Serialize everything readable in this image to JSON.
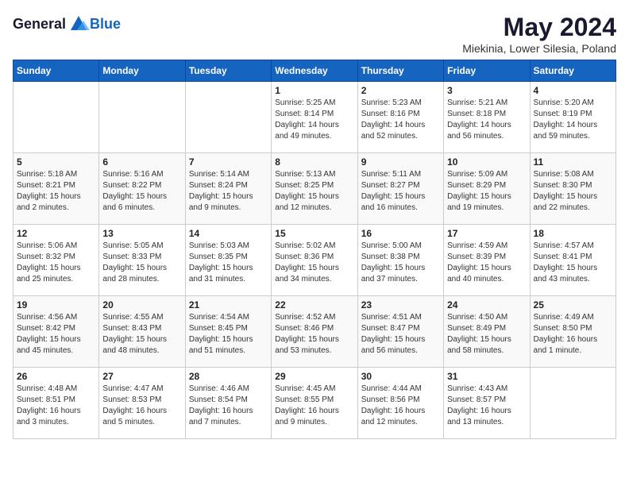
{
  "logo": {
    "text_general": "General",
    "text_blue": "Blue"
  },
  "title": "May 2024",
  "location": "Miekinia, Lower Silesia, Poland",
  "weekdays": [
    "Sunday",
    "Monday",
    "Tuesday",
    "Wednesday",
    "Thursday",
    "Friday",
    "Saturday"
  ],
  "weeks": [
    [
      {
        "day": "",
        "sunrise": "",
        "sunset": "",
        "daylight": ""
      },
      {
        "day": "",
        "sunrise": "",
        "sunset": "",
        "daylight": ""
      },
      {
        "day": "",
        "sunrise": "",
        "sunset": "",
        "daylight": ""
      },
      {
        "day": "1",
        "sunrise": "Sunrise: 5:25 AM",
        "sunset": "Sunset: 8:14 PM",
        "daylight": "Daylight: 14 hours and 49 minutes."
      },
      {
        "day": "2",
        "sunrise": "Sunrise: 5:23 AM",
        "sunset": "Sunset: 8:16 PM",
        "daylight": "Daylight: 14 hours and 52 minutes."
      },
      {
        "day": "3",
        "sunrise": "Sunrise: 5:21 AM",
        "sunset": "Sunset: 8:18 PM",
        "daylight": "Daylight: 14 hours and 56 minutes."
      },
      {
        "day": "4",
        "sunrise": "Sunrise: 5:20 AM",
        "sunset": "Sunset: 8:19 PM",
        "daylight": "Daylight: 14 hours and 59 minutes."
      }
    ],
    [
      {
        "day": "5",
        "sunrise": "Sunrise: 5:18 AM",
        "sunset": "Sunset: 8:21 PM",
        "daylight": "Daylight: 15 hours and 2 minutes."
      },
      {
        "day": "6",
        "sunrise": "Sunrise: 5:16 AM",
        "sunset": "Sunset: 8:22 PM",
        "daylight": "Daylight: 15 hours and 6 minutes."
      },
      {
        "day": "7",
        "sunrise": "Sunrise: 5:14 AM",
        "sunset": "Sunset: 8:24 PM",
        "daylight": "Daylight: 15 hours and 9 minutes."
      },
      {
        "day": "8",
        "sunrise": "Sunrise: 5:13 AM",
        "sunset": "Sunset: 8:25 PM",
        "daylight": "Daylight: 15 hours and 12 minutes."
      },
      {
        "day": "9",
        "sunrise": "Sunrise: 5:11 AM",
        "sunset": "Sunset: 8:27 PM",
        "daylight": "Daylight: 15 hours and 16 minutes."
      },
      {
        "day": "10",
        "sunrise": "Sunrise: 5:09 AM",
        "sunset": "Sunset: 8:29 PM",
        "daylight": "Daylight: 15 hours and 19 minutes."
      },
      {
        "day": "11",
        "sunrise": "Sunrise: 5:08 AM",
        "sunset": "Sunset: 8:30 PM",
        "daylight": "Daylight: 15 hours and 22 minutes."
      }
    ],
    [
      {
        "day": "12",
        "sunrise": "Sunrise: 5:06 AM",
        "sunset": "Sunset: 8:32 PM",
        "daylight": "Daylight: 15 hours and 25 minutes."
      },
      {
        "day": "13",
        "sunrise": "Sunrise: 5:05 AM",
        "sunset": "Sunset: 8:33 PM",
        "daylight": "Daylight: 15 hours and 28 minutes."
      },
      {
        "day": "14",
        "sunrise": "Sunrise: 5:03 AM",
        "sunset": "Sunset: 8:35 PM",
        "daylight": "Daylight: 15 hours and 31 minutes."
      },
      {
        "day": "15",
        "sunrise": "Sunrise: 5:02 AM",
        "sunset": "Sunset: 8:36 PM",
        "daylight": "Daylight: 15 hours and 34 minutes."
      },
      {
        "day": "16",
        "sunrise": "Sunrise: 5:00 AM",
        "sunset": "Sunset: 8:38 PM",
        "daylight": "Daylight: 15 hours and 37 minutes."
      },
      {
        "day": "17",
        "sunrise": "Sunrise: 4:59 AM",
        "sunset": "Sunset: 8:39 PM",
        "daylight": "Daylight: 15 hours and 40 minutes."
      },
      {
        "day": "18",
        "sunrise": "Sunrise: 4:57 AM",
        "sunset": "Sunset: 8:41 PM",
        "daylight": "Daylight: 15 hours and 43 minutes."
      }
    ],
    [
      {
        "day": "19",
        "sunrise": "Sunrise: 4:56 AM",
        "sunset": "Sunset: 8:42 PM",
        "daylight": "Daylight: 15 hours and 45 minutes."
      },
      {
        "day": "20",
        "sunrise": "Sunrise: 4:55 AM",
        "sunset": "Sunset: 8:43 PM",
        "daylight": "Daylight: 15 hours and 48 minutes."
      },
      {
        "day": "21",
        "sunrise": "Sunrise: 4:54 AM",
        "sunset": "Sunset: 8:45 PM",
        "daylight": "Daylight: 15 hours and 51 minutes."
      },
      {
        "day": "22",
        "sunrise": "Sunrise: 4:52 AM",
        "sunset": "Sunset: 8:46 PM",
        "daylight": "Daylight: 15 hours and 53 minutes."
      },
      {
        "day": "23",
        "sunrise": "Sunrise: 4:51 AM",
        "sunset": "Sunset: 8:47 PM",
        "daylight": "Daylight: 15 hours and 56 minutes."
      },
      {
        "day": "24",
        "sunrise": "Sunrise: 4:50 AM",
        "sunset": "Sunset: 8:49 PM",
        "daylight": "Daylight: 15 hours and 58 minutes."
      },
      {
        "day": "25",
        "sunrise": "Sunrise: 4:49 AM",
        "sunset": "Sunset: 8:50 PM",
        "daylight": "Daylight: 16 hours and 1 minute."
      }
    ],
    [
      {
        "day": "26",
        "sunrise": "Sunrise: 4:48 AM",
        "sunset": "Sunset: 8:51 PM",
        "daylight": "Daylight: 16 hours and 3 minutes."
      },
      {
        "day": "27",
        "sunrise": "Sunrise: 4:47 AM",
        "sunset": "Sunset: 8:53 PM",
        "daylight": "Daylight: 16 hours and 5 minutes."
      },
      {
        "day": "28",
        "sunrise": "Sunrise: 4:46 AM",
        "sunset": "Sunset: 8:54 PM",
        "daylight": "Daylight: 16 hours and 7 minutes."
      },
      {
        "day": "29",
        "sunrise": "Sunrise: 4:45 AM",
        "sunset": "Sunset: 8:55 PM",
        "daylight": "Daylight: 16 hours and 9 minutes."
      },
      {
        "day": "30",
        "sunrise": "Sunrise: 4:44 AM",
        "sunset": "Sunset: 8:56 PM",
        "daylight": "Daylight: 16 hours and 12 minutes."
      },
      {
        "day": "31",
        "sunrise": "Sunrise: 4:43 AM",
        "sunset": "Sunset: 8:57 PM",
        "daylight": "Daylight: 16 hours and 13 minutes."
      },
      {
        "day": "",
        "sunrise": "",
        "sunset": "",
        "daylight": ""
      }
    ]
  ]
}
